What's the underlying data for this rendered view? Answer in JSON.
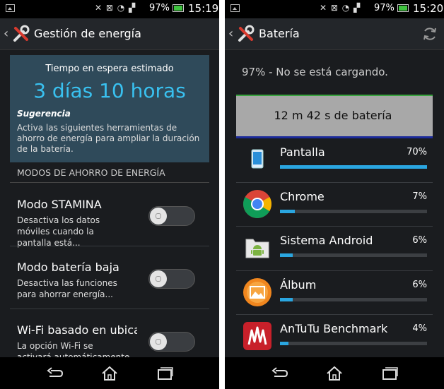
{
  "left": {
    "status": {
      "battery": "97%",
      "time": "15:19"
    },
    "title": "Gestión de energía",
    "estimate": {
      "label": "Tiempo en espera estimado",
      "value": "3 días 10 horas"
    },
    "suggestion": {
      "title": "Sugerencia",
      "text": "Activa las siguientes herramientas de ahorro de energía para ampliar la duración de la batería."
    },
    "section_header": "MODOS DE AHORRO DE ENERGÍA",
    "modes": [
      {
        "title": "Modo STAMINA",
        "desc": "Desactiva los datos móviles cuando la pantalla está...",
        "enabled": false
      },
      {
        "title": "Modo batería baja",
        "desc": "Desactiva las funciones para ahorrar energía...",
        "enabled": false
      },
      {
        "title": "Wi-Fi basado en ubicación",
        "desc": "La opción Wi-Fi se activará automáticamente cuando...",
        "enabled": false
      }
    ]
  },
  "right": {
    "status": {
      "battery": "97%",
      "time": "15:20"
    },
    "title": "Batería",
    "battery_status": "97% - No se está cargando.",
    "chart_label": "12 m 42 s de batería",
    "apps": [
      {
        "name": "Pantalla",
        "pct": "70%",
        "fraction": 1.0,
        "icon": "screen-icon"
      },
      {
        "name": "Chrome",
        "pct": "7%",
        "fraction": 0.1,
        "icon": "chrome-icon"
      },
      {
        "name": "Sistema Android",
        "pct": "6%",
        "fraction": 0.086,
        "icon": "android-icon"
      },
      {
        "name": "Álbum",
        "pct": "6%",
        "fraction": 0.086,
        "icon": "album-icon"
      },
      {
        "name": "AnTuTu Benchmark",
        "pct": "4%",
        "fraction": 0.057,
        "icon": "antutu-icon"
      }
    ]
  },
  "colors": {
    "accent": "#39c1f0",
    "bar": "#2aa6e0",
    "panel": "#2f4a5a"
  }
}
